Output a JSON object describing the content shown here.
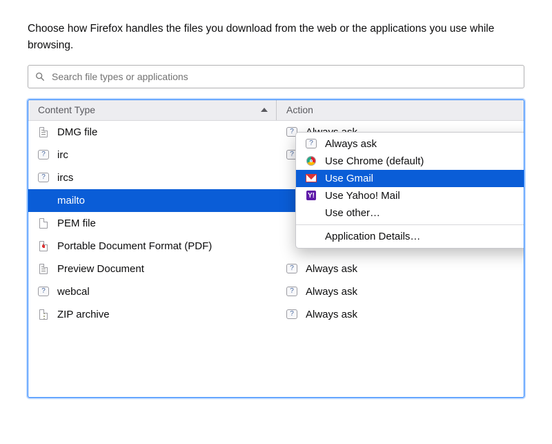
{
  "description": "Choose how Firefox handles the files you download from the web or the applications you use while browsing.",
  "search": {
    "placeholder": "Search file types or applications"
  },
  "columns": {
    "content_type": "Content Type",
    "action": "Action"
  },
  "rows": [
    {
      "type": "DMG file",
      "action": "Always ask",
      "icon": "doc-dark",
      "action_icon": "question"
    },
    {
      "type": "irc",
      "action": "Always ask",
      "icon": "question",
      "action_icon": "question"
    },
    {
      "type": "ircs",
      "action": "",
      "icon": "question",
      "action_icon": ""
    },
    {
      "type": "mailto",
      "action": "",
      "icon": "blank",
      "action_icon": "",
      "selected": true
    },
    {
      "type": "PEM file",
      "action": "",
      "icon": "doc",
      "action_icon": ""
    },
    {
      "type": "Portable Document Format (PDF)",
      "action": "",
      "icon": "doc-pdf",
      "action_icon": ""
    },
    {
      "type": "Preview Document",
      "action": "Always ask",
      "icon": "doc-dark",
      "action_icon": "question"
    },
    {
      "type": "webcal",
      "action": "Always ask",
      "icon": "question",
      "action_icon": "question"
    },
    {
      "type": "ZIP archive",
      "action": "Always ask",
      "icon": "doc-zip",
      "action_icon": "question"
    }
  ],
  "menu": {
    "items": [
      {
        "label": "Always ask",
        "icon": "question"
      },
      {
        "label": "Use Chrome (default)",
        "icon": "chrome"
      },
      {
        "label": "Use Gmail",
        "icon": "gmail",
        "highlight": true
      },
      {
        "label": "Use Yahoo! Mail",
        "icon": "yahoo"
      }
    ],
    "use_other": "Use other…",
    "app_details": "Application Details…"
  }
}
